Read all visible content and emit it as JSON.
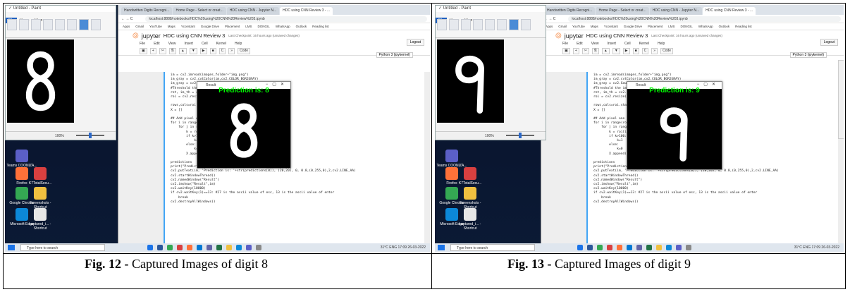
{
  "figures": [
    {
      "caption_label": "Fig. 12 -",
      "caption_text": " Captured Images of digit 8",
      "paint_title": "✓ Untitled - Paint",
      "paint_tabs": [
        "File",
        "Home",
        "View"
      ],
      "paint_zoom": "100%",
      "digit_glyph": "8",
      "desktop_icons": [
        {
          "label": "Teams COONIZA...",
          "color": "#5b5fc7"
        },
        {
          "label": "Firefox",
          "color": "#ff7139"
        },
        {
          "label": "Google Chrome",
          "color": "#34a853"
        },
        {
          "label": "Microsoft Edge",
          "color": "#0c88d8"
        },
        {
          "label": "K7TotalSecu...",
          "color": "#d94040"
        },
        {
          "label": "Screenshots - Shortcut",
          "color": "#f0c040"
        },
        {
          "label": "captured_i... - Shortcut",
          "color": "#e6e6e6"
        }
      ],
      "browser_tabs": [
        "Handwritten Digits Recogni...",
        "Home Page - Select or creat...",
        "HDC using CNN - Jupyter N...",
        "HDC using CNN Review 3 - ..."
      ],
      "url": "localhost:8888/notebooks/HDC%20using%20CNN%20Review%203.ipynb",
      "bookmarks": [
        "Apps",
        "Gmail",
        "YouTube",
        "Maps",
        "Yconstant",
        "Google Drive",
        "Placement",
        "LMS",
        "DONGIL",
        "WhatsApp",
        "Outlook",
        "Reading list"
      ],
      "notebook_title": "HDC using CNN Review 3",
      "checkpoint": "Last Checkpoint: 16 hours ago  (unsaved changes)",
      "jupyter_word": "jupyter",
      "menu": [
        "File",
        "Edit",
        "View",
        "Insert",
        "Cell",
        "Kernel",
        "Help"
      ],
      "kernel": "Python 3 (ipykernel)",
      "cell_type": "Code",
      "logout": "Logout",
      "result_title": "Result",
      "prediction": "Prediction is: 8",
      "code_lines": [
        "im = cv2.imread(images_folder+\"img.png\")",
        "im_gray = cv2.cvtColor(im,cv2.COLOR_BGR2GRAY)",
        "im_gray = cv2.GaussianBlur(im_gray,(15,15),0)",
        "#Threshold the image",
        "ret, im_th = cv2.threshold(im_gray,100,255,cv2.THRESH_BINARY)",
        "roi = cv2.resize(im_th,(28,28),interpolation=cv2.INTER_AREA)",
        "",
        "rows,cols=roi.shape",
        "X = []",
        "",
        "## Add pixel one by one into data array",
        "for i in range(rows):",
        "    for j in range(cols):",
        "        k = roi[i,j]",
        "        if k>100:",
        "            k=1",
        "        else:",
        "            k=0",
        "        X.append(k)",
        "",
        "predictions",
        "print(\"Prediction is:\",predictions[0])",
        "cv2.putText(im, 'Prediction is: '+str(predictions[0]), (20,20), 0, 0.8,(0,255,0),2,cv2.LINE_AA)",
        "cv2.startWindowThread()",
        "cv2.namedWindow(\"Result\")",
        "cv2.imshow(\"Result\",im)",
        "cv2.waitKey(10000)",
        "if cv2.waitKey(1)==13: #27 is the ascii value of esc, 13 is the ascii value of enter",
        "    break",
        "cv2.destroyAllWindows()"
      ],
      "taskbar_search": "Type here to search",
      "tray": "31°C  ENG  17:09  26-03-2022"
    },
    {
      "caption_label": "Fig. 13 -",
      "caption_text": " Captured Images of digit 9",
      "paint_title": "✓ Untitled - Paint",
      "paint_tabs": [
        "File",
        "Home",
        "View"
      ],
      "paint_zoom": "100%",
      "digit_glyph": "9",
      "desktop_icons": [
        {
          "label": "Teams COONIZA...",
          "color": "#5b5fc7"
        },
        {
          "label": "Firefox",
          "color": "#ff7139"
        },
        {
          "label": "Google Chrome",
          "color": "#34a853"
        },
        {
          "label": "Microsoft Edge",
          "color": "#0c88d8"
        },
        {
          "label": "K7TotalSecu...",
          "color": "#d94040"
        },
        {
          "label": "Screenshots - Shortcut",
          "color": "#f0c040"
        },
        {
          "label": "captured_i... - Shortcut",
          "color": "#e6e6e6"
        }
      ],
      "browser_tabs": [
        "Handwritten Digits Recogni...",
        "Home Page - Select or creat...",
        "HDC using CNN - Jupyter N...",
        "HDC using CNN Review 3 - ..."
      ],
      "url": "localhost:8888/notebooks/HDC%20using%20CNN%20Review%203.ipynb",
      "bookmarks": [
        "Apps",
        "Gmail",
        "YouTube",
        "Maps",
        "Yconstant",
        "Google Drive",
        "Placement",
        "LMS",
        "DONGIL",
        "WhatsApp",
        "Outlook",
        "Reading list"
      ],
      "notebook_title": "HDC using CNN Review 3",
      "checkpoint": "Last Checkpoint: 16 hours ago  (unsaved changes)",
      "jupyter_word": "jupyter",
      "menu": [
        "File",
        "Edit",
        "View",
        "Insert",
        "Cell",
        "Kernel",
        "Help"
      ],
      "kernel": "Python 3 (ipykernel)",
      "cell_type": "Code",
      "logout": "Logout",
      "result_title": "Result",
      "prediction": "Prediction is: 9",
      "code_lines": [
        "im = cv2.imread(images_folder+\"img.png\")",
        "im_gray = cv2.cvtColor(im,cv2.COLOR_BGR2GRAY)",
        "im_gray = cv2.GaussianBlur(im_gray,(15,15),0)",
        "#Threshold the image",
        "ret, im_th = cv2.threshold(im_gray,100,255,cv2.THRESH_BINARY)",
        "roi = cv2.resize(im_th,(28,28),interpolation=cv2.INTER_AREA)",
        "",
        "rows,cols=roi.shape",
        "X = []",
        "",
        "## Add pixel one by one into data array",
        "for i in range(rows):",
        "    for j in range(cols):",
        "        k = roi[i,j]",
        "        if k>100:",
        "            k=1",
        "        else:",
        "            k=0",
        "        X.append(k)",
        "",
        "predictions",
        "print(\"Prediction is:\",predictions[0])",
        "cv2.putText(im, 'Prediction is: '+str(predictions[0]), (20,20), 0, 0.8,(0,255,0),2,cv2.LINE_AA)",
        "cv2.startWindowThread()",
        "cv2.namedWindow(\"Result\")",
        "cv2.imshow(\"Result\",im)",
        "cv2.waitKey(10000)",
        "if cv2.waitKey(1)==13: #27 is the ascii value of esc, 13 is the ascii value of enter",
        "    break",
        "cv2.destroyAllWindows()"
      ],
      "taskbar_search": "Type here to search",
      "tray": "31°C  ENG  17:09  26-03-2022"
    }
  ]
}
